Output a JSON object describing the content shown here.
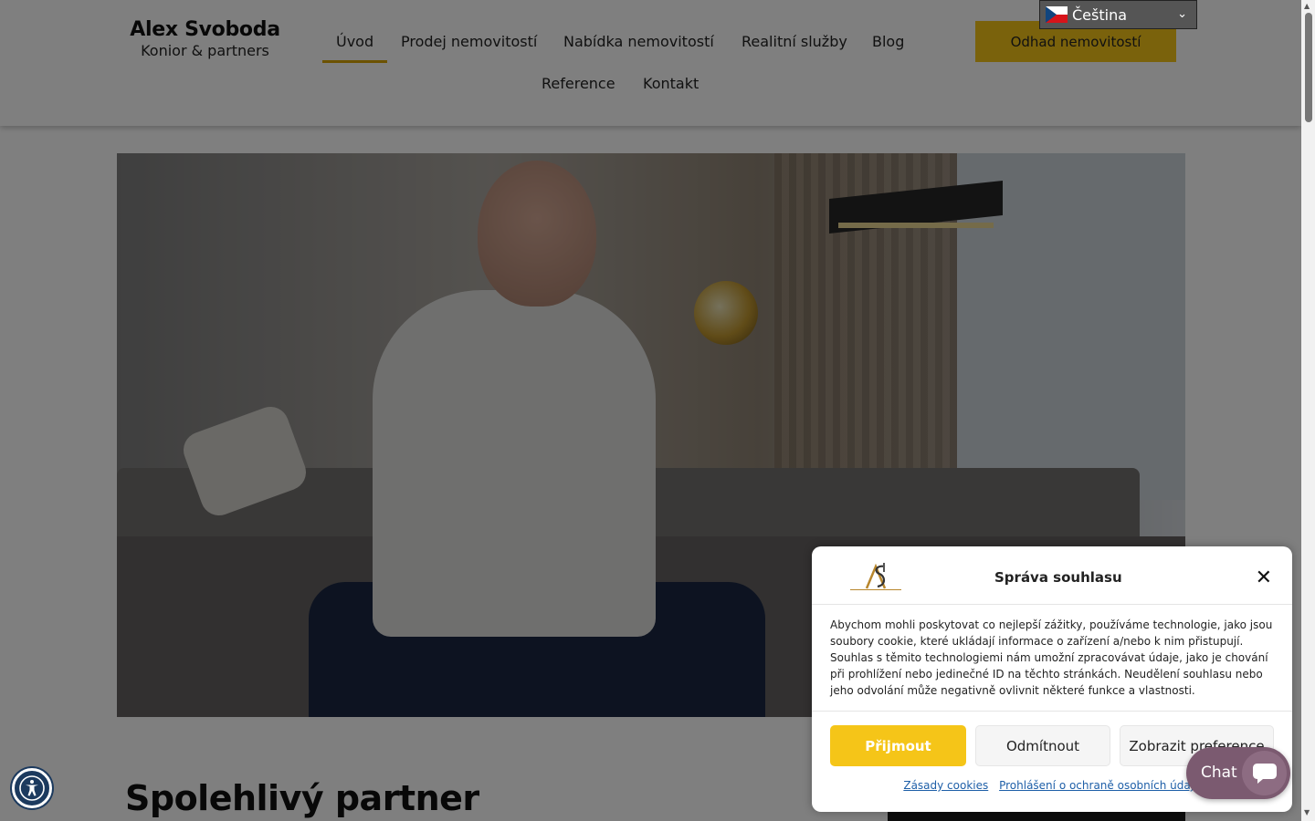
{
  "header": {
    "brand_name": "Alex Svoboda",
    "brand_sub": "Konior & partners",
    "nav": [
      {
        "label": "Úvod",
        "active": true
      },
      {
        "label": "Prodej nemovitostí"
      },
      {
        "label": "Nabídka nemovitostí"
      },
      {
        "label": "Realitní služby"
      },
      {
        "label": "Blog"
      },
      {
        "label": "Reference"
      },
      {
        "label": "Kontakt"
      }
    ],
    "cta_label": "Odhad nemovitostí",
    "language": "Čeština",
    "accent_color": "#f5c518"
  },
  "main": {
    "heading": "Spolehlivý partner"
  },
  "consent": {
    "title": "Správa souhlasu",
    "body": "Abychom mohli poskytovat co nejlepší zážitky, používáme technologie, jako jsou soubory cookie, které ukládají informace o zařízení a/nebo k nim přistupují. Souhlas s těmito technologiemi nám umožní zpracovávat údaje, jako je chování při prohlížení nebo jedinečné ID na těchto stránkách. Neudělení souhlasu nebo jeho odvolání může negativně ovlivnit některé funkce a vlastnosti.",
    "accept_label": "Přijmout",
    "deny_label": "Odmítnout",
    "prefs_label": "Zobrazit preference",
    "link_cookies": "Zásady cookies",
    "link_privacy": "Prohlášení o ochraně osobních údajů"
  },
  "chat": {
    "label": "Chat"
  },
  "icons": {
    "close": "close-icon",
    "accessibility": "accessibility-icon",
    "chat": "chat-bubble-icon",
    "language_chevron": "chevron-down-icon",
    "flag": "czech-flag-icon"
  }
}
